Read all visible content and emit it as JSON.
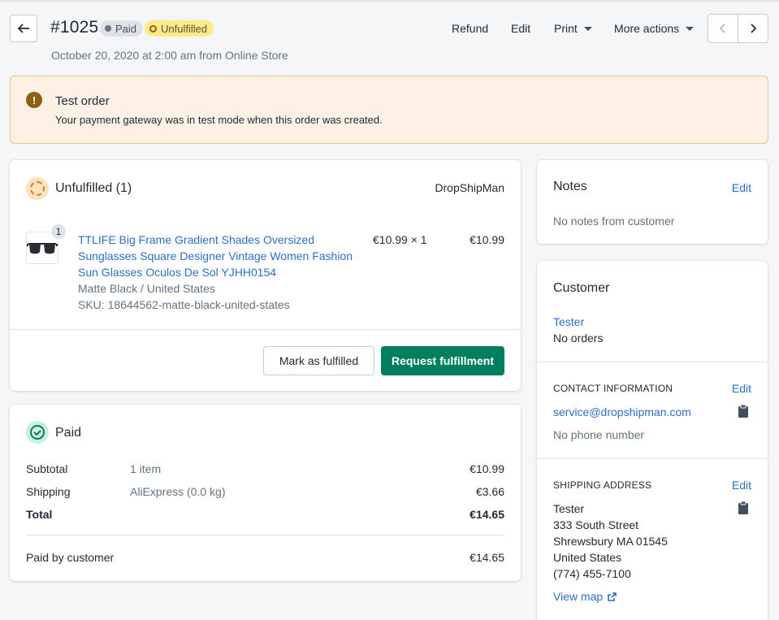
{
  "header": {
    "order_number": "#1025",
    "badge_paid": "Paid",
    "badge_unfulfilled": "Unfulfilled",
    "date_line": "October 20, 2020 at 2:00 am from Online Store",
    "actions": {
      "refund": "Refund",
      "edit": "Edit",
      "print": "Print",
      "more": "More actions"
    }
  },
  "banner": {
    "title": "Test order",
    "text": "Your payment gateway was in test mode when this order was created."
  },
  "fulfillment": {
    "title": "Unfulfilled (1)",
    "vendor": "DropShipMan",
    "item": {
      "quantity": "1",
      "title": "TTLIFE Big Frame Gradient Shades Oversized Sunglasses Square Designer Vintage Women Fashion Sun Glasses Oculos De Sol YJHH0154",
      "variant": "Matte Black / United States",
      "sku": "SKU: 18644562-matte-black-united-states",
      "unit_price": "€10.99 × 1",
      "line_total": "€10.99"
    },
    "buttons": {
      "mark_fulfilled": "Mark as fulfilled",
      "request": "Request fulfillment"
    }
  },
  "payment": {
    "title": "Paid",
    "rows": [
      {
        "label": "Subtotal",
        "detail": "1 item",
        "amount": "€10.99"
      },
      {
        "label": "Shipping",
        "detail": "AliExpress (0.0 kg)",
        "amount": "€3.66"
      },
      {
        "label": "Total",
        "detail": "",
        "amount": "€14.65"
      }
    ],
    "paid_by": {
      "label": "Paid by customer",
      "amount": "€14.65"
    }
  },
  "notes": {
    "title": "Notes",
    "edit": "Edit",
    "empty": "No notes from customer"
  },
  "customer": {
    "title": "Customer",
    "name": "Tester",
    "orders": "No orders",
    "contact": {
      "heading": "CONTACT INFORMATION",
      "edit": "Edit",
      "email": "service@dropshipman.com",
      "phone": "No phone number"
    },
    "shipping": {
      "heading": "SHIPPING ADDRESS",
      "edit": "Edit",
      "lines": [
        "Tester",
        "333 South Street",
        "Shrewsbury MA 01545",
        "United States",
        "(774) 455-7100"
      ],
      "view_map": "View map"
    }
  },
  "colors": {
    "primary": "#007f5f",
    "link": "#2c6ecb",
    "banner_bg": "#fcf1e4",
    "unfulfilled_badge": "#ffea8a"
  }
}
